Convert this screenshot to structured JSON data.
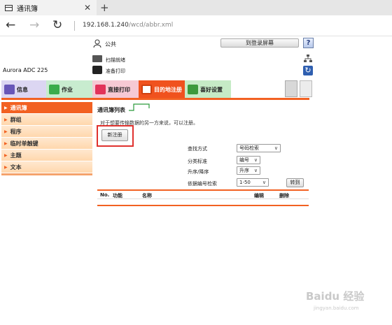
{
  "browser": {
    "tab_title": "通讯簿",
    "close_glyph": "✕",
    "new_tab_glyph": "+",
    "back_glyph": "←",
    "forward_glyph": "→",
    "reload_glyph": "↻",
    "url_host": "192.168.1.240",
    "url_path": "/wcd/abbr.xml"
  },
  "header": {
    "user_label": "公共",
    "login_button": "到登录屏幕",
    "help_button": "?",
    "scan_label": "扫描就绪",
    "print_label": "准备打印",
    "device_model": "Aurora ADC 225",
    "refresh_glyph": "↻"
  },
  "tabs": [
    {
      "label": "信息"
    },
    {
      "label": "作业"
    },
    {
      "label": "直接打印"
    },
    {
      "label": "目的地注册"
    },
    {
      "label": "喜好设置"
    }
  ],
  "sidebar": {
    "items": [
      {
        "label": "通讯簿"
      },
      {
        "label": "群组"
      },
      {
        "label": "程序"
      },
      {
        "label": "临时单触键"
      },
      {
        "label": "主题"
      },
      {
        "label": "文本"
      }
    ]
  },
  "main": {
    "title": "通讯簿列表",
    "description": "对于想要传输数据的另一方来说，可以注册。",
    "new_button": "新注册",
    "search_method_label": "查找方式",
    "search_method_value": "号码检索",
    "category_label": "分类标准",
    "category_value": "编号",
    "order_label": "升序/降序",
    "order_value": "升序",
    "range_label": "依据编号检索",
    "range_value": "1-50",
    "goto_button": "转到",
    "table_headers": {
      "no": "No.",
      "function": "功能",
      "name": "名称",
      "edit": "编辑",
      "delete": "删除"
    }
  },
  "watermark": {
    "text": "Baidu 经验",
    "sub": "jingyan.baidu.com"
  },
  "colors": {
    "accent": "#f26122",
    "highlight_box": "#e0322e"
  }
}
